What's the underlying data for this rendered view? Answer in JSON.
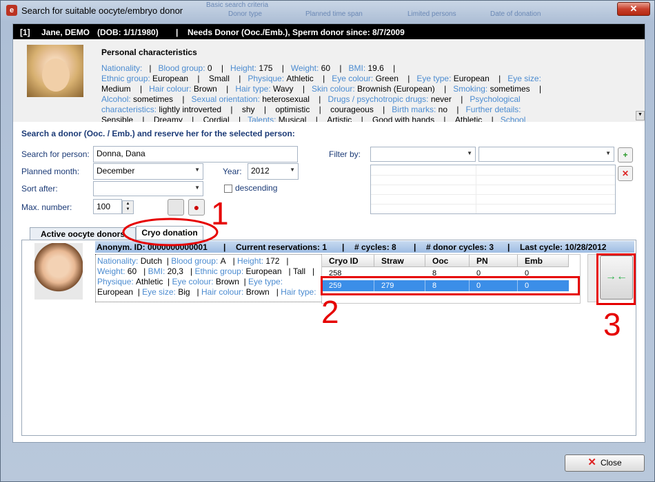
{
  "window": {
    "title": "Search for suitable oocyte/embryo donor",
    "close_glyph": "✕",
    "app_icon_glyph": "e"
  },
  "background_header": {
    "a": "Basic search criteria",
    "b": "Donor type",
    "c": "Planned time span",
    "d": "Limited persons",
    "e": "Date of donation"
  },
  "patient_bar": {
    "id": "[1]",
    "name": "Jane, DEMO",
    "dob": "(DOB: 1/1/1980)",
    "sep": "|",
    "needs": "Needs Donor (Ooc./Emb.), Sperm donor  since: 8/7/2009"
  },
  "personal": {
    "title": "Personal characteristics",
    "lines": [
      [
        [
          "Nationality:",
          "lbl"
        ],
        [
          "   |   ",
          ""
        ],
        [
          "Blood group:",
          "lbl"
        ],
        [
          " 0    |   ",
          ""
        ],
        [
          "Height:",
          "lbl"
        ],
        [
          " 175    |   ",
          ""
        ],
        [
          "Weight:",
          "lbl"
        ],
        [
          " 60    |   ",
          ""
        ],
        [
          "BMI:",
          "lbl"
        ],
        [
          " 19.6    |",
          ""
        ]
      ],
      [
        [
          "Ethnic group:",
          "lbl"
        ],
        [
          " European    |    Small    |   ",
          ""
        ],
        [
          "Physique:",
          "lbl"
        ],
        [
          " Athletic    |   ",
          ""
        ],
        [
          "Eye colour:",
          "lbl"
        ],
        [
          " Green    |   ",
          ""
        ],
        [
          "Eye type:",
          "lbl"
        ],
        [
          " European    |   ",
          ""
        ],
        [
          "Eye size:",
          "lbl"
        ]
      ],
      [
        [
          "Medium    |   ",
          ""
        ],
        [
          "Hair colour:",
          "lbl"
        ],
        [
          " Brown    |   ",
          ""
        ],
        [
          "Hair type:",
          "lbl"
        ],
        [
          " Wavy    |   ",
          ""
        ],
        [
          "Skin colour:",
          "lbl"
        ],
        [
          " Brownish (European)    |   ",
          ""
        ],
        [
          "Smoking:",
          "lbl"
        ],
        [
          " sometimes    |",
          ""
        ]
      ],
      [
        [
          "Alcohol:",
          "lbl"
        ],
        [
          " sometimes    |   ",
          ""
        ],
        [
          "Sexual orientation:",
          "lbl"
        ],
        [
          " heterosexual    |   ",
          ""
        ],
        [
          "Drugs / psychotropic drugs:",
          "lbl"
        ],
        [
          " never    |   ",
          ""
        ],
        [
          "Psychological",
          "lbl"
        ]
      ],
      [
        [
          "characteristics:",
          "lbl"
        ],
        [
          " lightly introverted    |    shy    |    optimistic    |    courageous    |   ",
          ""
        ],
        [
          "Birth marks:",
          "lbl"
        ],
        [
          " no    |   ",
          ""
        ],
        [
          "Further details:",
          "lbl"
        ]
      ],
      [
        [
          "Sensible    |    Dreamy    |    Cordial    |   ",
          ""
        ],
        [
          "Talents:",
          "lbl"
        ],
        [
          " Musical    |    Artistic    |    Good with hands    |    Athletic    |   ",
          ""
        ],
        [
          "School",
          "lbl"
        ]
      ]
    ]
  },
  "search": {
    "heading": "Search a donor (Ooc. / Emb.) and reserve her for the selected person:",
    "person_label": "Search for person:",
    "person_value": "Donna, Dana",
    "month_label": "Planned month:",
    "month_value": "December",
    "year_label": "Year:",
    "year_value": "2012",
    "sort_label": "Sort after:",
    "sort_value": "",
    "descending_label": "descending",
    "max_label": "Max. number:",
    "max_value": "100",
    "filter_label": "Filter by:",
    "filter1_value": "",
    "filter2_value": ""
  },
  "tabs": [
    {
      "label": "Active oocyte donors"
    },
    {
      "label": "Cryo donation"
    }
  ],
  "donor": {
    "anon_id": "Anonym. ID: 0000000000001",
    "reservations": "Current reservations: 1",
    "cycles": "# cycles: 8",
    "donor_cycles": "# donor cycles: 3",
    "last_cycle": "Last cycle: 10/28/2012",
    "sep": "|",
    "details": [
      [
        [
          "Nationality:",
          "lbl"
        ],
        [
          " Dutch  | ",
          ""
        ],
        [
          "Blood group:",
          "lbl"
        ],
        [
          " A   | ",
          ""
        ],
        [
          "Height:",
          "lbl"
        ],
        [
          " 172   |",
          ""
        ]
      ],
      [
        [
          "Weight:",
          "lbl"
        ],
        [
          " 60   | ",
          ""
        ],
        [
          "BMI:",
          "lbl"
        ],
        [
          " 20,3   | ",
          ""
        ],
        [
          "Ethnic group:",
          "lbl"
        ],
        [
          " European   | Tall   |",
          ""
        ]
      ],
      [
        [
          "Physique:",
          "lbl"
        ],
        [
          " Athletic  | ",
          ""
        ],
        [
          "Eye colour:",
          "lbl"
        ],
        [
          " Brown  | ",
          ""
        ],
        [
          "Eye type:",
          "lbl"
        ]
      ],
      [
        [
          "European  | ",
          ""
        ],
        [
          "Eye size:",
          "lbl"
        ],
        [
          " Big   | ",
          ""
        ],
        [
          "Hair colour:",
          "lbl"
        ],
        [
          " Brown   | ",
          ""
        ],
        [
          "Hair type:",
          "lbl"
        ]
      ]
    ]
  },
  "cryo_table": {
    "headers": [
      "Cryo ID",
      "Straw",
      "Ooc",
      "PN",
      "Emb"
    ],
    "rows": [
      [
        "258",
        "",
        "8",
        "0",
        "0"
      ],
      [
        "259",
        "279",
        "8",
        "0",
        "0"
      ]
    ],
    "selected_row": 1
  },
  "reserve_button": {
    "glyph": "→←"
  },
  "close_button": {
    "label": "Close",
    "glyph": "✕"
  },
  "annotations": {
    "one": "1",
    "two": "2",
    "three": "3"
  },
  "colors": {
    "label": "#4b8bd0",
    "annotation": "#e60000",
    "selection": "#3b8ee8"
  },
  "icons": [
    "app-icon",
    "close-icon",
    "person-icon",
    "blood-drop-icon",
    "add-filter-icon",
    "delete-filter-icon",
    "reserve-arrows-icon",
    "chevron-down-icon"
  ]
}
